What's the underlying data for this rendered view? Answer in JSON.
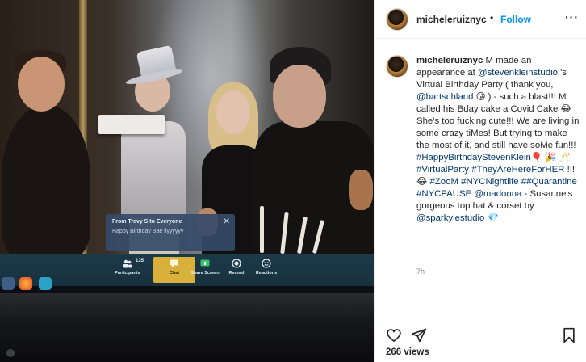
{
  "header": {
    "username": "micheleruiznyc",
    "separator": "•",
    "follow_label": "Follow",
    "more_label": "···"
  },
  "caption": {
    "username": "micheleruiznyc",
    "p1": " M made an appearance at ",
    "mention_studio": "@stevenkleinstudio",
    "p2": " 's Virtual Birthday Party ( thank you, ",
    "mention_bart": "@bartschland",
    "emoji_1": "😘",
    "p3": " ) - such a blast!!! M called his Bday cake a Covid Cake ",
    "emoji_2": "😂",
    "p4": " She's too fucking cute!!! We are living in some crazy tiMes! But trying to make the most of it, and still have soMe fun!!! ",
    "tag_happy": "#HappyBirthdayStevenKlein",
    "emoji_3": "🎈",
    "emoji_4": "🎉",
    "emoji_5": "🥂",
    "tag_virtual": "#VirtualParty",
    "tag_here": "#TheyAreHereForHER",
    "p5": " !!! ",
    "emoji_6": "😂",
    "tag_zoom": "#ZooM",
    "tag_nyc": "#NYCNightlife",
    "tag_quar": "##Quarantine",
    "tag_pause": "#NYCPAUSE",
    "mention_madonna": "@madonna",
    "p6": " - Susanne's gorgeous top hat & corset by ",
    "mention_sparky": "@sparkylestudio",
    "emoji_7": "💎",
    "time": "7h"
  },
  "zoom": {
    "chat_from": "From Trevy S to Everyone",
    "chat_message": "Happy Birthday Bae llyyyyyy",
    "chat_close": "✕",
    "participants_count": "135",
    "participants_label": "Participants",
    "chat_label": "Chat",
    "share_label": "Share Screen",
    "record_label": "Record",
    "reactions_label": "Reactions"
  },
  "footer": {
    "views": "266 views"
  },
  "icons": {
    "heart": "heart-icon",
    "share": "paper-plane-icon",
    "save": "bookmark-icon",
    "more": "ellipsis-icon",
    "close": "close-icon"
  },
  "colors": {
    "follow": "#0095f6",
    "link": "#00376b",
    "text": "#262626",
    "muted": "#8e8e8e",
    "zoom_bar": "#1b3a4a",
    "zoom_chat": "#d9b13a"
  }
}
